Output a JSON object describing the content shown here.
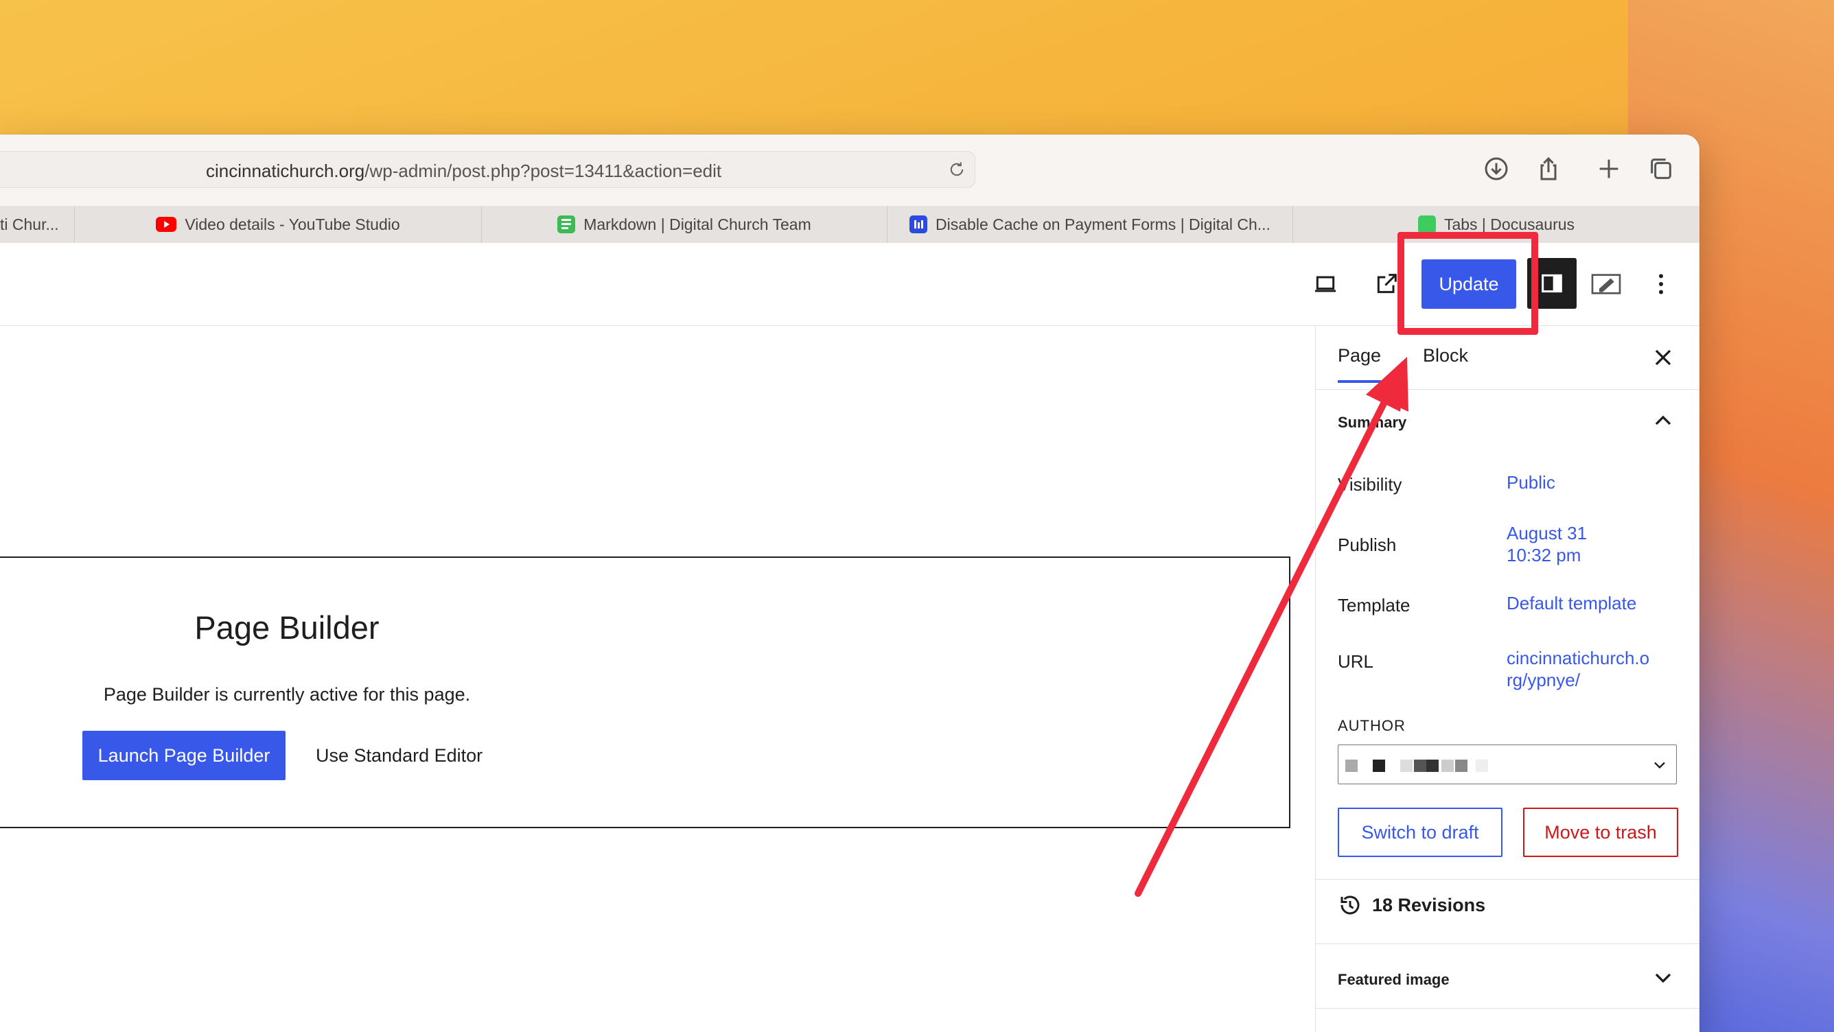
{
  "browser": {
    "url_domain": "cincinnatichurch.org",
    "url_path": "/wp-admin/post.php?post=13411&action=edit",
    "icons": [
      "download-icon",
      "share-icon",
      "new-tab-icon",
      "tab-overview-icon"
    ]
  },
  "tabs": [
    {
      "label": "ti Chur...",
      "icon": "none"
    },
    {
      "label": "Video details - YouTube Studio",
      "icon": "youtube-icon"
    },
    {
      "label": "Markdown | Digital Church Team",
      "icon": "document-icon"
    },
    {
      "label": "Disable Cache on Payment Forms | Digital Ch...",
      "icon": "bars-icon"
    },
    {
      "label": "Tabs | Docusaurus",
      "icon": "docusaurus-icon"
    }
  ],
  "header": {
    "update_label": "Update"
  },
  "builder": {
    "title": "Page Builder",
    "description": "Page Builder is currently active for this page.",
    "launch_label": "Launch Page Builder",
    "standard_label": "Use Standard Editor"
  },
  "sidebar": {
    "tabs": [
      "Page",
      "Block"
    ],
    "summary_title": "Summary",
    "rows": [
      {
        "label": "Visibility",
        "value": "Public"
      },
      {
        "label": "Publish",
        "value_line1": "August 31",
        "value_line2": "10:32 pm"
      },
      {
        "label": "Template",
        "value": "Default template"
      },
      {
        "label": "URL",
        "value_line1": "cincinnatichurch.o",
        "value_line2": "rg/ypnye/"
      }
    ],
    "author_label": "AUTHOR",
    "switch_draft_label": "Switch to draft",
    "trash_label": "Move to trash",
    "revisions_label": "18 Revisions",
    "featured_image_label": "Featured image"
  },
  "colors": {
    "accent": "#3858e9",
    "danger": "#cc1818",
    "annotation": "#ee2a3c"
  }
}
